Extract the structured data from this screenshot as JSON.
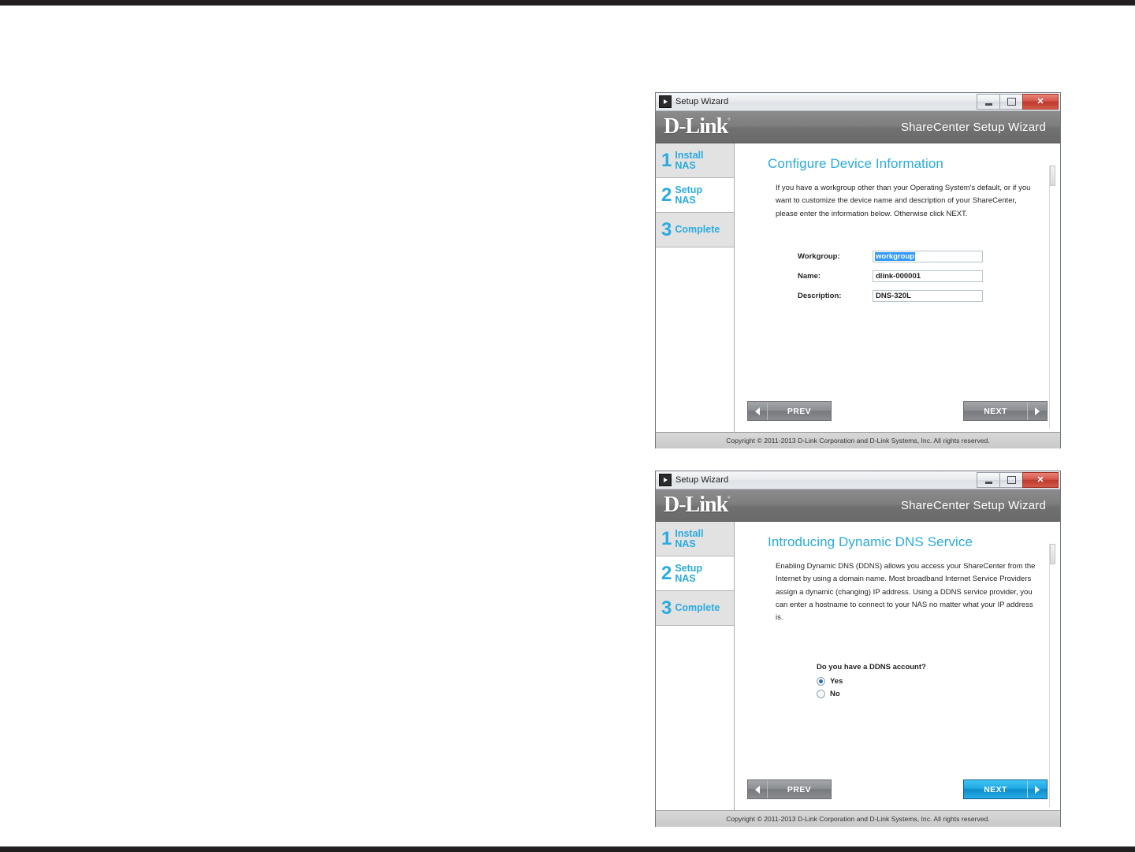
{
  "windows": [
    {
      "titlebar": {
        "title": "Setup Wizard",
        "icon": "dlink-app-icon",
        "minimize_label": "",
        "maximize_label": "",
        "close_label": "✕"
      },
      "brand": {
        "logo_text": "D-Link",
        "logo_mark": "°",
        "header_title": "ShareCenter Setup Wizard"
      },
      "sidebar": {
        "steps": [
          {
            "number": "1",
            "label": "Install\nNAS",
            "state": "inactive"
          },
          {
            "number": "2",
            "label": "Setup\nNAS",
            "state": "active"
          },
          {
            "number": "3",
            "label": "Complete",
            "state": "inactive"
          }
        ]
      },
      "content": {
        "heading": "Configure Device Information",
        "description": "If you have a workgroup other than your Operating System's default, or if you want to customize the device name and description of your ShareCenter, please enter the information below. Otherwise click NEXT.",
        "form": {
          "fields": [
            {
              "label": "Workgroup:",
              "value": "workgroup",
              "selected": true
            },
            {
              "label": "Name:",
              "value": "dlink-000001",
              "selected": false
            },
            {
              "label": "Description:",
              "value": "DNS-320L",
              "selected": false
            }
          ]
        }
      },
      "nav": {
        "prev_label": "PREV",
        "next_label": "NEXT",
        "prev_style": "grey",
        "next_style": "grey"
      },
      "footer": {
        "copyright": "Copyright © 2011-2013 D-Link Corporation and D-Link Systems, Inc. All rights reserved."
      }
    },
    {
      "titlebar": {
        "title": "Setup Wizard",
        "icon": "dlink-app-icon",
        "minimize_label": "",
        "maximize_label": "",
        "close_label": "✕"
      },
      "brand": {
        "logo_text": "D-Link",
        "logo_mark": "°",
        "header_title": "ShareCenter Setup Wizard"
      },
      "sidebar": {
        "steps": [
          {
            "number": "1",
            "label": "Install\nNAS",
            "state": "inactive"
          },
          {
            "number": "2",
            "label": "Setup\nNAS",
            "state": "active"
          },
          {
            "number": "3",
            "label": "Complete",
            "state": "inactive"
          }
        ]
      },
      "content": {
        "heading": "Introducing Dynamic DNS Service",
        "description": "Enabling Dynamic DNS (DDNS) allows you access your ShareCenter from the Internet by using a domain name. Most broadband Internet Service Providers assign a dynamic (changing) IP address. Using a DDNS service provider, you can enter a hostname to connect to your NAS no matter what your IP address is.",
        "question": {
          "title": "Do you have a DDNS account?",
          "options": [
            {
              "label": "Yes",
              "checked": true
            },
            {
              "label": "No",
              "checked": false
            }
          ]
        }
      },
      "nav": {
        "prev_label": "PREV",
        "next_label": "NEXT",
        "prev_style": "grey",
        "next_style": "blue"
      },
      "footer": {
        "copyright": "Copyright © 2011-2013 D-Link Corporation and D-Link Systems, Inc. All rights reserved."
      }
    }
  ],
  "colors": {
    "brand_accent": "#29abe2",
    "header_grey": "#7e7e7e",
    "selection_blue": "#3399ff",
    "close_red": "#bc3a2c",
    "next_active_blue": "#1fa8e4"
  }
}
